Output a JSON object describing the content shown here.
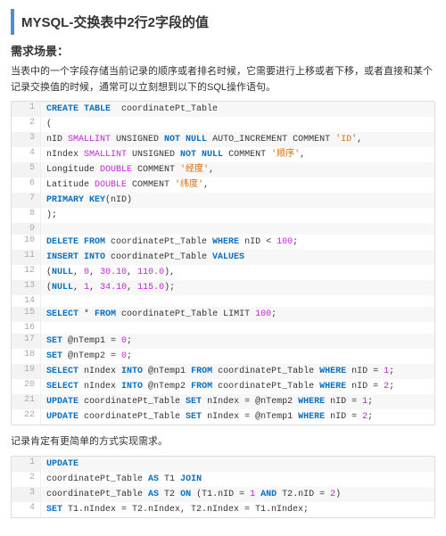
{
  "title": "MYSQL-交换表中2行2字段的值",
  "section1_head": "需求场景：",
  "section1_para": "当表中的一个字段存储当前记录的顺序或者排名时候，它需要进行上移或者下移，或者直接和某个记录交换值的时候，通常可以立刻想到以下的SQL操作语句。",
  "block1": [
    {
      "n": "1",
      "seg": [
        [
          "kw",
          "CREATE TABLE"
        ],
        [
          "",
          "  coordinatePt_Table"
        ]
      ]
    },
    {
      "n": "2",
      "seg": [
        [
          "",
          "("
        ]
      ]
    },
    {
      "n": "3",
      "seg": [
        [
          "",
          "nID "
        ],
        [
          "ty",
          "SMALLINT"
        ],
        [
          "",
          " UNSIGNED "
        ],
        [
          "kw",
          "NOT NULL"
        ],
        [
          "",
          " AUTO_INCREMENT COMMENT "
        ],
        [
          "str",
          "'ID'"
        ],
        [
          "",
          ","
        ]
      ]
    },
    {
      "n": "4",
      "seg": [
        [
          "",
          "nIndex "
        ],
        [
          "ty",
          "SMALLINT"
        ],
        [
          "",
          " UNSIGNED "
        ],
        [
          "kw",
          "NOT NULL"
        ],
        [
          "",
          " COMMENT "
        ],
        [
          "str",
          "'顺序'"
        ],
        [
          "",
          ","
        ]
      ]
    },
    {
      "n": "5",
      "seg": [
        [
          "",
          "Longitude "
        ],
        [
          "ty",
          "DOUBLE"
        ],
        [
          "",
          " COMMENT "
        ],
        [
          "str",
          "'经度'"
        ],
        [
          "",
          ","
        ]
      ]
    },
    {
      "n": "6",
      "seg": [
        [
          "",
          "Latitude "
        ],
        [
          "ty",
          "DOUBLE"
        ],
        [
          "",
          " COMMENT "
        ],
        [
          "str",
          "'纬度'"
        ],
        [
          "",
          ","
        ]
      ]
    },
    {
      "n": "7",
      "seg": [
        [
          "kw",
          "PRIMARY KEY"
        ],
        [
          "",
          "(nID)"
        ]
      ]
    },
    {
      "n": "8",
      "seg": [
        [
          "",
          ");"
        ]
      ]
    },
    {
      "n": "9",
      "seg": [
        [
          "",
          ""
        ]
      ]
    },
    {
      "n": "10",
      "seg": [
        [
          "kw",
          "DELETE FROM"
        ],
        [
          "",
          " coordinatePt_Table "
        ],
        [
          "kw",
          "WHERE"
        ],
        [
          "",
          " nID < "
        ],
        [
          "num",
          "100"
        ],
        [
          "",
          ";"
        ]
      ]
    },
    {
      "n": "11",
      "seg": [
        [
          "kw",
          "INSERT INTO"
        ],
        [
          "",
          " coordinatePt_Table "
        ],
        [
          "kw",
          "VALUES"
        ]
      ]
    },
    {
      "n": "12",
      "seg": [
        [
          "",
          "("
        ],
        [
          "kw",
          "NULL"
        ],
        [
          "",
          ", "
        ],
        [
          "num",
          "0"
        ],
        [
          "",
          ", "
        ],
        [
          "num",
          "30.10"
        ],
        [
          "",
          ", "
        ],
        [
          "num",
          "110.0"
        ],
        [
          "",
          "),"
        ]
      ]
    },
    {
      "n": "13",
      "seg": [
        [
          "",
          "("
        ],
        [
          "kw",
          "NULL"
        ],
        [
          "",
          ", "
        ],
        [
          "num",
          "1"
        ],
        [
          "",
          ", "
        ],
        [
          "num",
          "34.10"
        ],
        [
          "",
          ", "
        ],
        [
          "num",
          "115.0"
        ],
        [
          "",
          ");"
        ]
      ]
    },
    {
      "n": "14",
      "seg": [
        [
          "",
          ""
        ]
      ]
    },
    {
      "n": "15",
      "seg": [
        [
          "kw",
          "SELECT"
        ],
        [
          "",
          " * "
        ],
        [
          "kw",
          "FROM"
        ],
        [
          "",
          " coordinatePt_Table LIMIT "
        ],
        [
          "num",
          "100"
        ],
        [
          "",
          ";"
        ]
      ]
    },
    {
      "n": "16",
      "seg": [
        [
          "",
          ""
        ]
      ]
    },
    {
      "n": "17",
      "seg": [
        [
          "kw",
          "SET"
        ],
        [
          "",
          " @nTemp1 = "
        ],
        [
          "num",
          "0"
        ],
        [
          "",
          ";"
        ]
      ]
    },
    {
      "n": "18",
      "seg": [
        [
          "kw",
          "SET"
        ],
        [
          "",
          " @nTemp2 = "
        ],
        [
          "num",
          "0"
        ],
        [
          "",
          ";"
        ]
      ]
    },
    {
      "n": "19",
      "seg": [
        [
          "kw",
          "SELECT"
        ],
        [
          "",
          " nIndex "
        ],
        [
          "kw",
          "INTO"
        ],
        [
          "",
          " @nTemp1 "
        ],
        [
          "kw",
          "FROM"
        ],
        [
          "",
          " coordinatePt_Table "
        ],
        [
          "kw",
          "WHERE"
        ],
        [
          "",
          " nID = "
        ],
        [
          "num",
          "1"
        ],
        [
          "",
          ";"
        ]
      ]
    },
    {
      "n": "20",
      "seg": [
        [
          "kw",
          "SELECT"
        ],
        [
          "",
          " nIndex "
        ],
        [
          "kw",
          "INTO"
        ],
        [
          "",
          " @nTemp2 "
        ],
        [
          "kw",
          "FROM"
        ],
        [
          "",
          " coordinatePt_Table "
        ],
        [
          "kw",
          "WHERE"
        ],
        [
          "",
          " nID = "
        ],
        [
          "num",
          "2"
        ],
        [
          "",
          ";"
        ]
      ]
    },
    {
      "n": "21",
      "seg": [
        [
          "kw",
          "UPDATE"
        ],
        [
          "",
          " coordinatePt_Table "
        ],
        [
          "kw",
          "SET"
        ],
        [
          "",
          " nIndex = @nTemp2 "
        ],
        [
          "kw",
          "WHERE"
        ],
        [
          "",
          " nID = "
        ],
        [
          "num",
          "1"
        ],
        [
          "",
          ";"
        ]
      ]
    },
    {
      "n": "22",
      "seg": [
        [
          "kw",
          "UPDATE"
        ],
        [
          "",
          " coordinatePt_Table "
        ],
        [
          "kw",
          "SET"
        ],
        [
          "",
          " nIndex = @nTemp1 "
        ],
        [
          "kw",
          "WHERE"
        ],
        [
          "",
          " nID = "
        ],
        [
          "num",
          "2"
        ],
        [
          "",
          ";"
        ]
      ]
    }
  ],
  "mid_para": "记录肯定有更简单的方式实现需求。",
  "block2": [
    {
      "n": "1",
      "seg": [
        [
          "kw",
          "UPDATE"
        ]
      ]
    },
    {
      "n": "2",
      "seg": [
        [
          "",
          "coordinatePt_Table "
        ],
        [
          "kw",
          "AS"
        ],
        [
          "",
          " T1 "
        ],
        [
          "kw",
          "JOIN"
        ]
      ]
    },
    {
      "n": "3",
      "seg": [
        [
          "",
          "coordinatePt_Table "
        ],
        [
          "kw",
          "AS"
        ],
        [
          "",
          " T2 "
        ],
        [
          "kw",
          "ON"
        ],
        [
          "",
          " (T1.nID = "
        ],
        [
          "num",
          "1"
        ],
        [
          "",
          " "
        ],
        [
          "kw",
          "AND"
        ],
        [
          "",
          " T2.nID = "
        ],
        [
          "num",
          "2"
        ],
        [
          "",
          ")"
        ]
      ]
    },
    {
      "n": "4",
      "seg": [
        [
          "kw",
          "SET"
        ],
        [
          "",
          " T1.nIndex = T2.nIndex, T2.nIndex = T1.nIndex;"
        ]
      ]
    }
  ]
}
